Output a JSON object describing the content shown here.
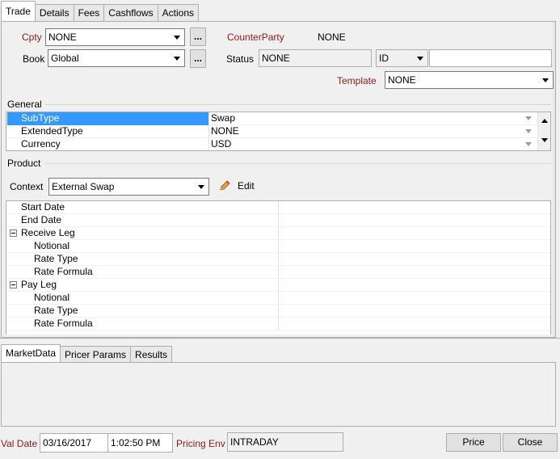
{
  "top_tabs": [
    "Trade",
    "Details",
    "Fees",
    "Cashflows",
    "Actions"
  ],
  "trade": {
    "cpty_label": "Cpty",
    "cpty_value": "NONE",
    "more_label": "...",
    "counterparty_label": "CounterParty",
    "counterparty_value": "NONE",
    "book_label": "Book",
    "book_value": "Global",
    "status_label": "Status",
    "status_value": "NONE",
    "id_type": "ID",
    "id_value": "",
    "template_label": "Template",
    "template_value": "NONE"
  },
  "general": {
    "title": "General",
    "rows": [
      {
        "label": "SubType",
        "value": "Swap",
        "selected": true
      },
      {
        "label": "ExtendedType",
        "value": "NONE",
        "selected": false
      },
      {
        "label": "Currency",
        "value": "USD",
        "selected": false
      }
    ]
  },
  "product": {
    "title": "Product",
    "context_label": "Context",
    "context_value": "External Swap",
    "edit_label": "Edit",
    "rows": [
      {
        "label": "Start Date",
        "level": 0,
        "group": false
      },
      {
        "label": "End Date",
        "level": 0,
        "group": false
      },
      {
        "label": "Receive Leg",
        "level": 0,
        "group": true
      },
      {
        "label": "Notional",
        "level": 1,
        "group": false
      },
      {
        "label": "Rate Type",
        "level": 1,
        "group": false
      },
      {
        "label": "Rate Formula",
        "level": 1,
        "group": false
      },
      {
        "label": "Pay Leg",
        "level": 0,
        "group": true
      },
      {
        "label": "Notional",
        "level": 1,
        "group": false
      },
      {
        "label": "Rate Type",
        "level": 1,
        "group": false
      },
      {
        "label": "Rate Formula",
        "level": 1,
        "group": false
      }
    ]
  },
  "bottom_tabs": [
    "MarketData",
    "Pricer Params",
    "Results"
  ],
  "footer": {
    "val_date_label": "Val Date",
    "val_date": "03/16/2017",
    "val_time": "1:02:50 PM",
    "pricing_env_label": "Pricing Env",
    "pricing_env": "INTRADAY",
    "price_button": "Price",
    "close_button": "Close"
  },
  "colors": {
    "accent_label": "#8b1a1a",
    "selection": "#3399ff"
  }
}
